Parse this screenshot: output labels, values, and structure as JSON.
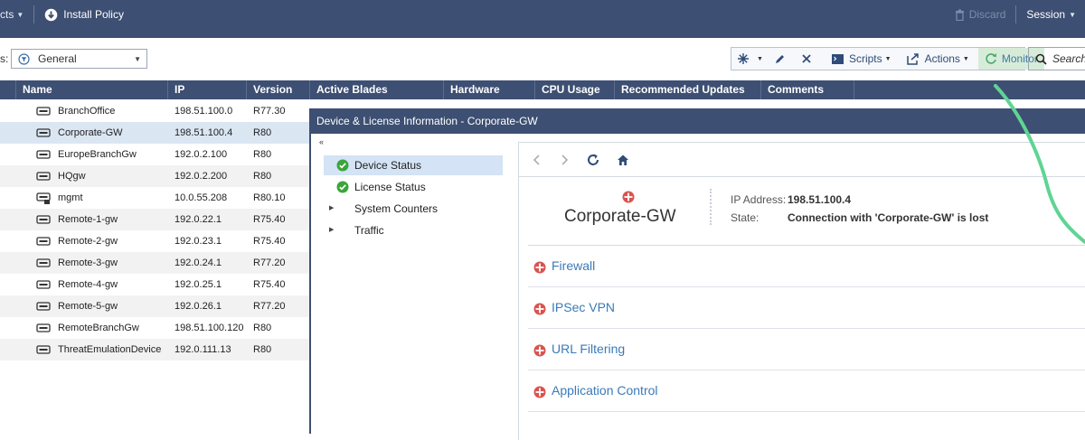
{
  "topbar": {
    "objects_label": "cts",
    "install_policy": "Install Policy",
    "discard": "Discard",
    "session": "Session"
  },
  "toolbar": {
    "filter_label": "s:",
    "filter_value": "General",
    "scripts": "Scripts",
    "actions": "Actions",
    "monitor": "Monitor",
    "search_placeholder": "Search"
  },
  "grid": {
    "columns": [
      "Name",
      "IP",
      "Version",
      "Active Blades",
      "Hardware",
      "CPU Usage",
      "Recommended Updates",
      "Comments"
    ],
    "rows": [
      {
        "name": "BranchOffice",
        "ip": "198.51.100.0",
        "version": "R77.30"
      },
      {
        "name": "Corporate-GW",
        "ip": "198.51.100.4",
        "version": "R80"
      },
      {
        "name": "EuropeBranchGw",
        "ip": "192.0.2.100",
        "version": "R80"
      },
      {
        "name": "HQgw",
        "ip": "192.0.2.200",
        "version": "R80"
      },
      {
        "name": "mgmt",
        "ip": "10.0.55.208",
        "version": "R80.10"
      },
      {
        "name": "Remote-1-gw",
        "ip": "192.0.22.1",
        "version": "R75.40"
      },
      {
        "name": "Remote-2-gw",
        "ip": "192.0.23.1",
        "version": "R75.40"
      },
      {
        "name": "Remote-3-gw",
        "ip": "192.0.24.1",
        "version": "R77.20"
      },
      {
        "name": "Remote-4-gw",
        "ip": "192.0.25.1",
        "version": "R75.40"
      },
      {
        "name": "Remote-5-gw",
        "ip": "192.0.26.1",
        "version": "R77.20"
      },
      {
        "name": "RemoteBranchGw",
        "ip": "198.51.100.120",
        "version": "R80"
      },
      {
        "name": "ThreatEmulationDevice",
        "ip": "192.0.111.13",
        "version": "R80"
      }
    ]
  },
  "dialog": {
    "title": "Device & License Information - Corporate-GW",
    "collapse": "«",
    "tree": [
      {
        "label": "Device Status"
      },
      {
        "label": "License Status"
      },
      {
        "label": "System Counters"
      },
      {
        "label": "Traffic"
      }
    ],
    "device": {
      "name": "Corporate-GW",
      "ip_label": "IP Address:",
      "ip_value": "198.51.100.4",
      "state_label": "State:",
      "state_value": "Connection with 'Corporate-GW' is lost"
    },
    "blades": [
      "Firewall",
      "IPSec VPN",
      "URL Filtering",
      "Application Control"
    ]
  },
  "colors": {
    "header_bg": "#3d4f72",
    "status_ok": "#3aa53a",
    "status_error": "#d9534f",
    "annotation": "#5fd494",
    "link": "#3a7ab8"
  }
}
